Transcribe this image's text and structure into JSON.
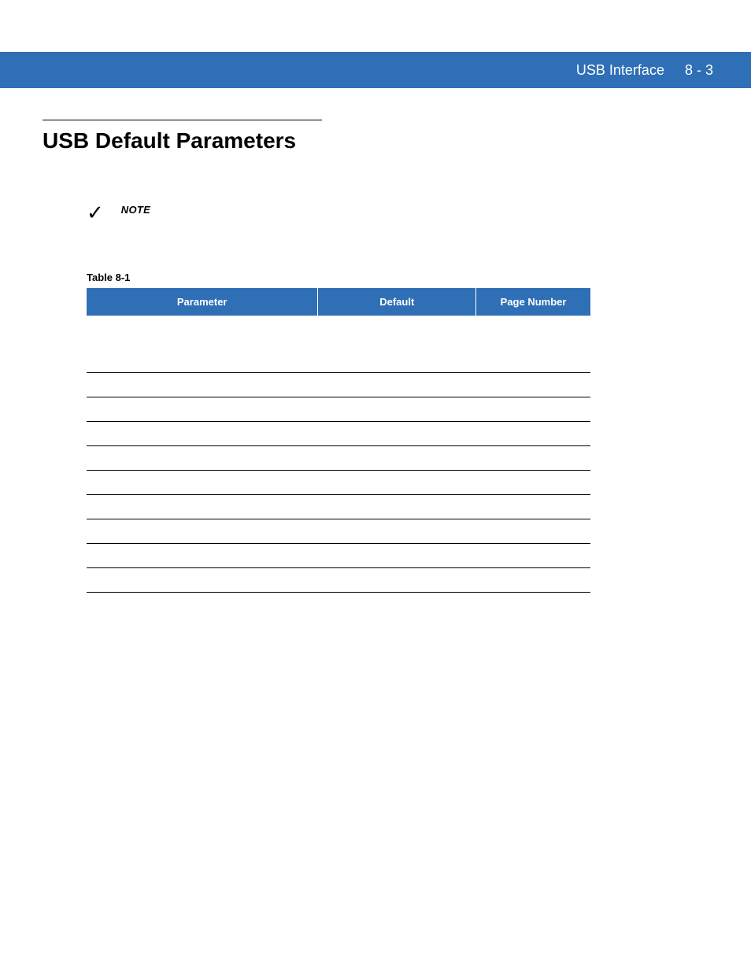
{
  "header": {
    "title": "USB Interface",
    "page": "8 - 3"
  },
  "section": {
    "title": "USB Default Parameters"
  },
  "note": {
    "icon": "✓",
    "label": "NOTE"
  },
  "table": {
    "label": "Table 8-1",
    "headers": {
      "parameter": "Parameter",
      "default": "Default",
      "page_number": "Page Number"
    },
    "rows": [
      {
        "parameter": "",
        "default": "",
        "page": ""
      },
      {
        "parameter": "",
        "default": "",
        "page": ""
      },
      {
        "parameter": "",
        "default": "",
        "page": ""
      },
      {
        "parameter": "",
        "default": "",
        "page": ""
      },
      {
        "parameter": "",
        "default": "",
        "page": ""
      },
      {
        "parameter": "",
        "default": "",
        "page": ""
      },
      {
        "parameter": "",
        "default": "",
        "page": ""
      },
      {
        "parameter": "",
        "default": "",
        "page": ""
      },
      {
        "parameter": "",
        "default": "",
        "page": ""
      },
      {
        "parameter": "",
        "default": "",
        "page": ""
      }
    ]
  }
}
